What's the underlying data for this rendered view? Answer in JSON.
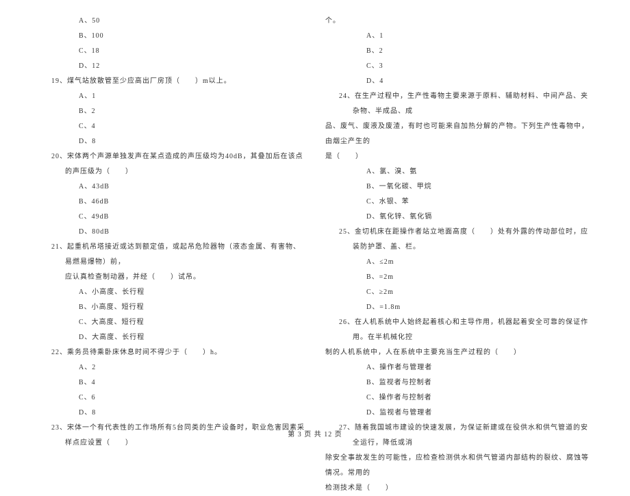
{
  "left_column": {
    "opts_18": {
      "a": "A、50",
      "b": "B、100",
      "c": "C、18",
      "d": "D、12"
    },
    "q19": "19、煤气站放散管至少应高出厂房顶（　　）m以上。",
    "opts_19": {
      "a": "A、1",
      "b": "B、2",
      "c": "C、4",
      "d": "D、8"
    },
    "q20": "20、宋体两个声源单独发声在某点造成的声压级均为40dB，其叠加后在该点的声压级为（　　）",
    "opts_20": {
      "a": "A、43dB",
      "b": "B、46dB",
      "c": "C、49dB",
      "d": "D、80dB"
    },
    "q21": "21、起重机吊塔接近或达到额定值，或起吊危险器物（液态金属、有害物、易燃易爆物）前，",
    "q21_cont": "应认真检查制动器，并经（　　）试吊。",
    "opts_21": {
      "a": "A、小高度、长行程",
      "b": "B、小高度、短行程",
      "c": "C、大高度、短行程",
      "d": "D、大高度、长行程"
    },
    "q22": "22、乘务员待乘卧床休息时间不得少于（　　）h。",
    "opts_22": {
      "a": "A、2",
      "b": "B、4",
      "c": "C、6",
      "d": "D、8"
    },
    "q23": "23、宋体一个有代表性的工作场所有5台同类的生产设备时，职业危害因素采样点应设置（　　）"
  },
  "right_column": {
    "q23_cont": "个。",
    "opts_23": {
      "a": "A、1",
      "b": "B、2",
      "c": "C、3",
      "d": "D、4"
    },
    "q24": "24、在生产过程中，生产性毒物主要来源于原料、辅助材料、中间产品、夹杂物、半成品、成",
    "q24_line2": "品、废气、废液及废渣，有时也可能来自加热分解的产物。下列生产性毒物中，由烟尘产生的",
    "q24_line3": "是（　　）",
    "opts_24": {
      "a": "A、氯、溴、氨",
      "b": "B、一氧化碳、甲烷",
      "c": "C、水银、苯",
      "d": "D、氧化锌、氧化镉"
    },
    "q25": "25、金切机床在距操作者站立地面高度（　　）处有外露的传动部位时，应装防护罩、盖、栏。",
    "opts_25": {
      "a": "A、≤2m",
      "b": "B、=2m",
      "c": "C、≥2m",
      "d": "D、=1.8m"
    },
    "q26": "26、在人机系统中人始终起着核心和主导作用，机器起着安全可靠的保证作用。在半机械化控",
    "q26_line2": "制的人机系统中，人在系统中主要充当生产过程的（　　）",
    "opts_26": {
      "a": "A、操作者与管理者",
      "b": "B、监视者与控制者",
      "c": "C、操作者与控制者",
      "d": "D、监视者与管理者"
    },
    "q27": "27、随着我国城市建设的快速发展，为保证新建或在役供水和供气管道的安全运行，降低或消",
    "q27_line2": "除安全事故发生的可能性，应检查检测供水和供气管道内部结构的裂纹、腐蚀等情况。常用的",
    "q27_line3": "检测技术是（　　）"
  },
  "footer": "第 3 页 共 12 页"
}
